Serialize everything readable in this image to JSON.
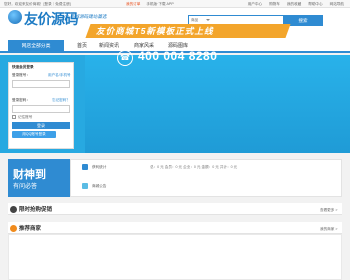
{
  "topbar": {
    "left_text": "您好，欢迎来友价商城！[登录｜免费注册]",
    "mid_badge": "我的订单",
    "mid_text": "手机版·下载 APP",
    "links": [
      "用户中心",
      "购物车",
      "我的收藏",
      "帮助中心",
      "网站导航"
    ]
  },
  "header": {
    "logo_text": "友价源码",
    "slogan": "YJ-商城源码建站首选",
    "search_category": "商品",
    "search_button": "搜索"
  },
  "nav": {
    "category_label": "网店全部分类",
    "items": [
      "首页",
      "新闻资讯",
      "商家风采",
      "源码图库"
    ]
  },
  "banner": {
    "title": "友价商城T5新模板正式上线",
    "phone": "400 004 8280"
  },
  "login": {
    "heading": "快速会员登录",
    "user_label": "登录账号：",
    "user_hint": "用户名/手机号",
    "pass_label": "登录密码：",
    "pass_hint": "忘记密码？",
    "remember": "记住账号",
    "submit": "登录",
    "qq_login": "用QQ账号登录"
  },
  "gold": {
    "title": "财神到",
    "subtitle": "有问必答",
    "items": [
      {
        "label": "获利统计",
        "stats": "总：0 元   会员：0 元   企业：0 元   金额：0 元   共计：0 元",
        "color": "#2f8bd2"
      },
      {
        "label": "商城公告",
        "stats": "",
        "color": "#5bbce4"
      }
    ]
  },
  "sections": [
    {
      "title": "限时抢购促销",
      "more": "查看更多 >",
      "color": "#444"
    },
    {
      "title": "推荐商家",
      "more": "我的商家 >",
      "color": "#f08b1d"
    }
  ]
}
